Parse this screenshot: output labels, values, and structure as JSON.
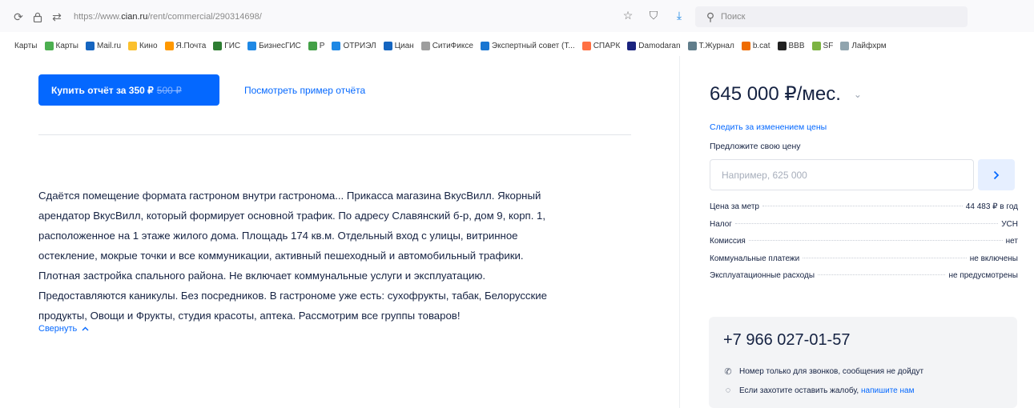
{
  "browser": {
    "url_prefix": "https://www.",
    "url_domain": "cian.ru",
    "url_path": "/rent/commercial/290314698/",
    "search_placeholder": "Поиск",
    "bookmarks": [
      {
        "label": "Карты",
        "color": "#ffffff"
      },
      {
        "label": "Карты",
        "color": "#4caf50"
      },
      {
        "label": "Mail.ru",
        "color": "#1565c0"
      },
      {
        "label": "Кино",
        "color": "#fbc02d"
      },
      {
        "label": "Я.Почта",
        "color": "#ff9800"
      },
      {
        "label": "ГИС",
        "color": "#2e7d32"
      },
      {
        "label": "БизнесГИС",
        "color": "#1e88e5"
      },
      {
        "label": "Р",
        "color": "#43a047"
      },
      {
        "label": "ОТРИЭЛ",
        "color": "#1e88e5"
      },
      {
        "label": "Циан",
        "color": "#1565c0"
      },
      {
        "label": "СитиФиксе",
        "color": "#9e9e9e"
      },
      {
        "label": "Экспертный совет (Т...",
        "color": "#1976d2"
      },
      {
        "label": "СПАРК",
        "color": "#ff7043"
      },
      {
        "label": "Damodaran",
        "color": "#1a237e"
      },
      {
        "label": "Т.Журнал",
        "color": "#607d8b"
      },
      {
        "label": "b.cat",
        "color": "#ef6c00"
      },
      {
        "label": "ВВВ",
        "color": "#212121"
      },
      {
        "label": "SF",
        "color": "#7cb342"
      },
      {
        "label": "Лайфхрм",
        "color": "#90a4ae"
      }
    ]
  },
  "report": {
    "buy_label": "Купить отчёт за 350 ₽",
    "old_price": "500 ₽",
    "sample_link": "Посмотреть пример отчёта"
  },
  "description": {
    "lines": [
      "Сдаётся помещение формата гастроном внутри гастронома... Прикасса магазина ВкусВилл. Якорный",
      "арендатор ВкусВилл, который формирует основной трафик. По адресу Славянский б-р, дом 9, корп. 1,",
      "расположенное на 1 этаже жилого дома. Площадь 174 кв.м. Отдельный вход с улицы, витринное",
      "остекление, мокрые точки и все коммуникации, активный пешеходный и автомобильный трафики.",
      "Плотная застройка спального района. Не включает коммунальные услуги и эксплуатацию.",
      "Предоставляются каникулы. Без посредников. В гастрономе уже есть: сухофрукты, табак, Белорусские",
      "продукты, Овощи и Фрукты, студия красоты, аптека. Рассмотрим все группы товаров!"
    ],
    "collapse_label": "Свернуть"
  },
  "sidebar": {
    "price": "645 000 ₽/мес.",
    "watch_price_link": "Следить за изменением цены",
    "offer_label": "Предложите свою цену",
    "offer_placeholder": "Например, 625 000",
    "facts": [
      {
        "label": "Цена за метр",
        "value": "44 483 ₽ в год"
      },
      {
        "label": "Налог",
        "value": "УСН"
      },
      {
        "label": "Комиссия",
        "value": "нет"
      },
      {
        "label": "Коммунальные платежи",
        "value": "не включены"
      },
      {
        "label": "Эксплуатационные расходы",
        "value": "не предусмотрены"
      }
    ],
    "phone": "+7 966 027-01-57",
    "phone_note": "Номер только для звонков, сообщения не дойдут",
    "complaint_text": "Если захотите оставить жалобу,",
    "complaint_link": "напишите нам"
  }
}
